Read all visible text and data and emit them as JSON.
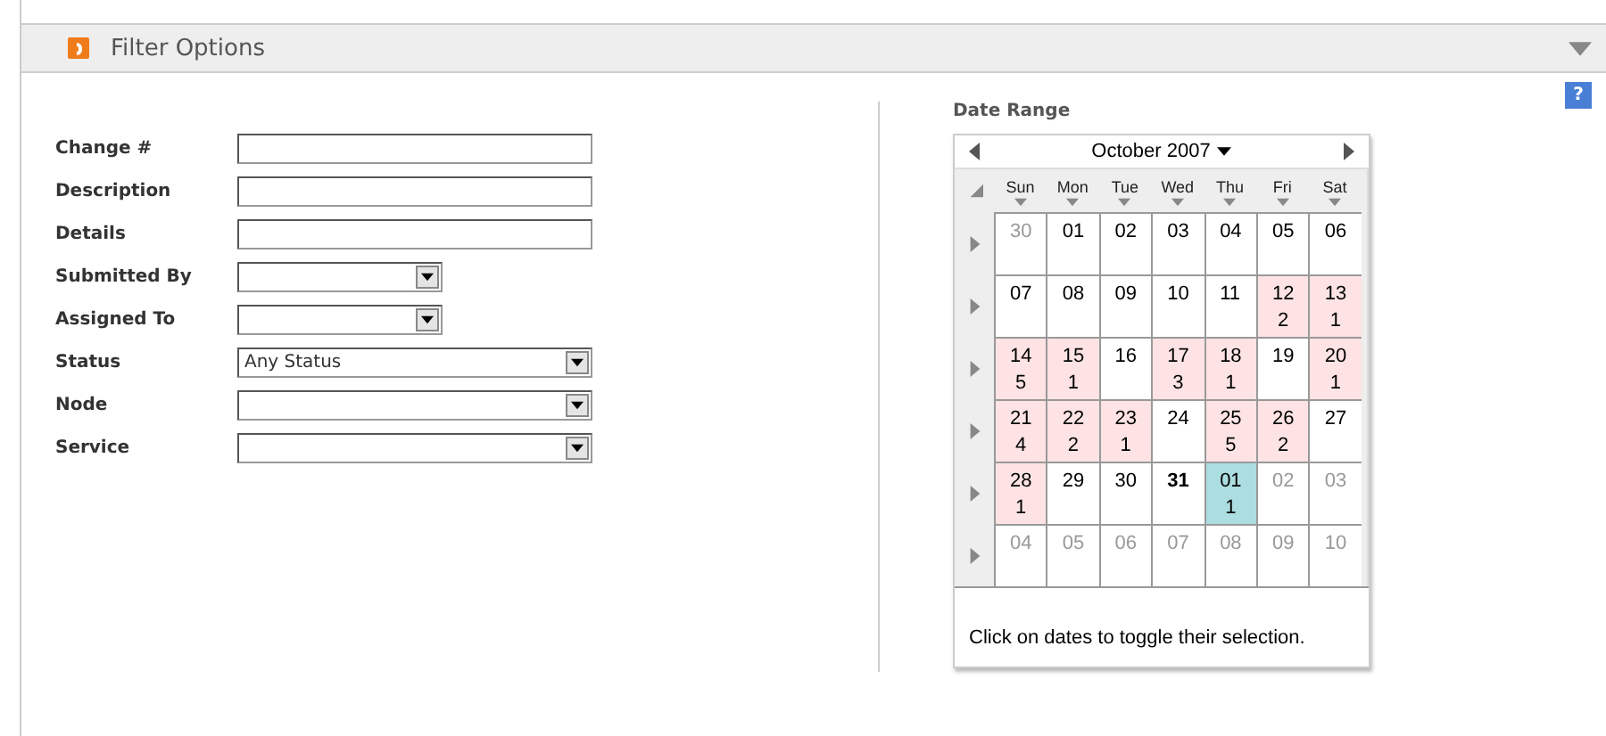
{
  "panel": {
    "title": "Filter Options",
    "expanded": true
  },
  "help": {
    "label": "?"
  },
  "fields": [
    {
      "kind": "text",
      "label": "Change #"
    },
    {
      "kind": "text",
      "label": "Description"
    },
    {
      "kind": "text",
      "label": "Details"
    },
    {
      "kind": "short-select",
      "label": "Submitted By"
    },
    {
      "kind": "short-select",
      "label": "Assigned To"
    },
    {
      "kind": "select",
      "label": "Status",
      "value": "Any Status"
    },
    {
      "kind": "select",
      "label": "Node"
    },
    {
      "kind": "select",
      "label": "Service"
    }
  ],
  "date_range": {
    "label": "Date Range",
    "month": "October 2007",
    "weekdays": [
      "Sun",
      "Mon",
      "Tue",
      "Wed",
      "Thu",
      "Fri",
      "Sat"
    ],
    "weeks": [
      [
        {
          "day": "30",
          "kind": "other",
          "selected": false
        },
        {
          "day": "01",
          "kind": "month",
          "selected": false
        },
        {
          "day": "02",
          "kind": "month",
          "selected": false
        },
        {
          "day": "03",
          "kind": "month",
          "selected": false
        },
        {
          "day": "04",
          "kind": "month",
          "selected": false
        },
        {
          "day": "05",
          "kind": "month",
          "selected": false
        },
        {
          "day": "06",
          "kind": "month",
          "selected": false
        }
      ],
      [
        {
          "day": "07",
          "kind": "month",
          "selected": false
        },
        {
          "day": "08",
          "kind": "month",
          "selected": false
        },
        {
          "day": "09",
          "kind": "month",
          "selected": false
        },
        {
          "day": "10",
          "kind": "month",
          "selected": false
        },
        {
          "day": "11",
          "kind": "month",
          "selected": false
        },
        {
          "day": "12",
          "count": "2",
          "kind": "month",
          "selected": false
        },
        {
          "day": "13",
          "count": "1",
          "kind": "month",
          "selected": false
        }
      ],
      [
        {
          "day": "14",
          "count": "5",
          "kind": "month",
          "selected": false
        },
        {
          "day": "15",
          "count": "1",
          "kind": "month",
          "selected": false
        },
        {
          "day": "16",
          "kind": "month",
          "selected": false
        },
        {
          "day": "17",
          "count": "3",
          "kind": "month",
          "selected": false
        },
        {
          "day": "18",
          "count": "1",
          "kind": "month",
          "selected": false
        },
        {
          "day": "19",
          "kind": "month",
          "selected": false
        },
        {
          "day": "20",
          "count": "1",
          "kind": "month",
          "selected": false
        }
      ],
      [
        {
          "day": "21",
          "count": "4",
          "kind": "month",
          "selected": false
        },
        {
          "day": "22",
          "count": "2",
          "kind": "month",
          "selected": false
        },
        {
          "day": "23",
          "count": "1",
          "kind": "month",
          "selected": false
        },
        {
          "day": "24",
          "kind": "month",
          "selected": false
        },
        {
          "day": "25",
          "count": "5",
          "kind": "month",
          "selected": false
        },
        {
          "day": "26",
          "count": "2",
          "kind": "month",
          "selected": false
        },
        {
          "day": "27",
          "kind": "month",
          "selected": false
        }
      ],
      [
        {
          "day": "28",
          "count": "1",
          "kind": "month",
          "selected": false
        },
        {
          "day": "29",
          "kind": "month",
          "selected": false
        },
        {
          "day": "30",
          "kind": "month",
          "selected": false
        },
        {
          "day": "31",
          "kind": "today",
          "selected": false
        },
        {
          "day": "01",
          "count": "1",
          "kind": "month",
          "selected": true
        },
        {
          "day": "02",
          "kind": "other",
          "selected": false
        },
        {
          "day": "03",
          "kind": "other",
          "selected": false
        }
      ],
      [
        {
          "day": "04",
          "kind": "other",
          "selected": false
        },
        {
          "day": "05",
          "kind": "other",
          "selected": false
        },
        {
          "day": "06",
          "kind": "other",
          "selected": false
        },
        {
          "day": "07",
          "kind": "other",
          "selected": false
        },
        {
          "day": "08",
          "kind": "other",
          "selected": false
        },
        {
          "day": "09",
          "kind": "other",
          "selected": false
        },
        {
          "day": "10",
          "kind": "other",
          "selected": false
        }
      ]
    ],
    "hint": "Click on dates to toggle their selection."
  }
}
